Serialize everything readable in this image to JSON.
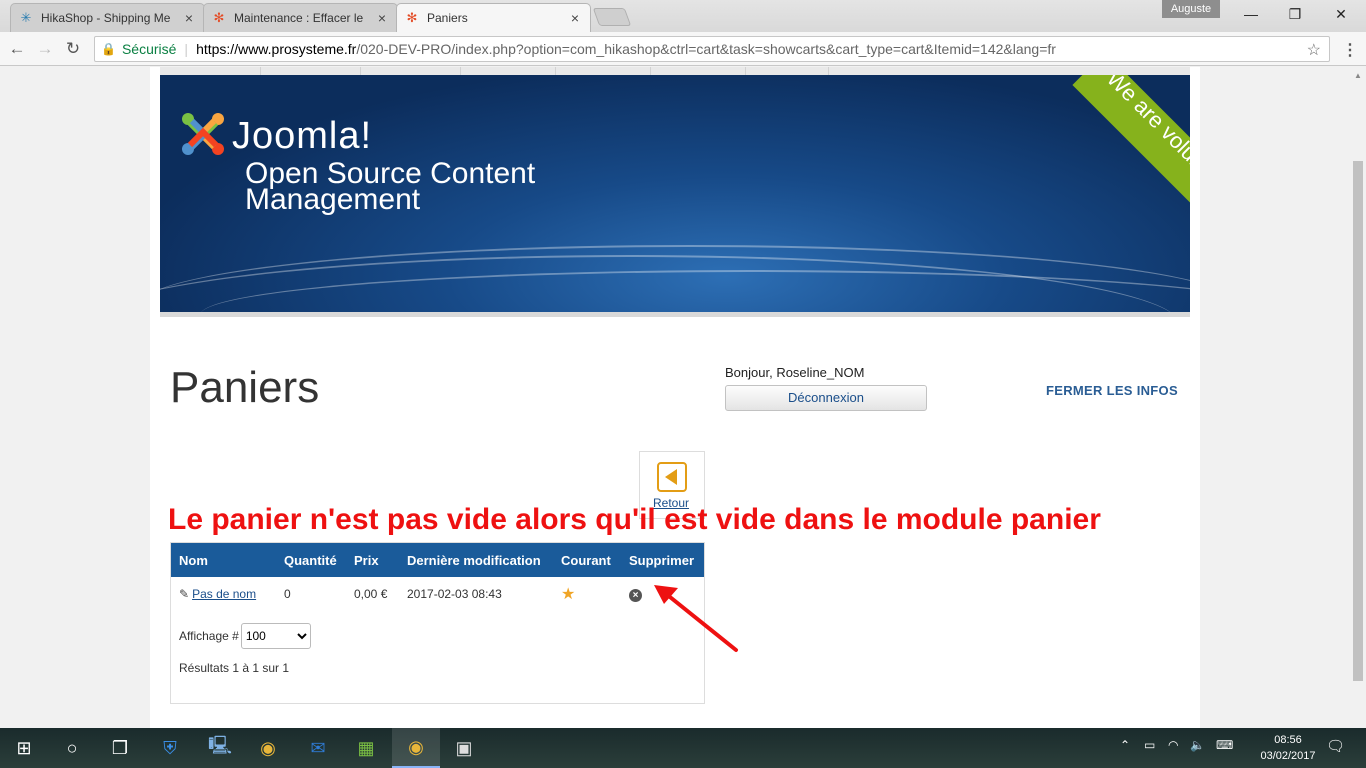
{
  "browser": {
    "tabs": [
      {
        "title": "HikaShop - Shipping Me",
        "favicon": "hikashop-icon"
      },
      {
        "title": "Maintenance : Effacer le",
        "favicon": "joomla-icon"
      },
      {
        "title": "Paniers",
        "favicon": "joomla-icon"
      }
    ],
    "profile_name": "Auguste",
    "secure_label": "Sécurisé",
    "url_host": "https://www.prosysteme.fr",
    "url_rest": "/020-DEV-PRO/index.php?option=com_hikashop&ctrl=cart&task=showcarts&cart_type=cart&Itemid=142&lang=fr"
  },
  "banner": {
    "brand": "Joomla!",
    "tagline_line1": "Open Source Content",
    "tagline_line2": "Management",
    "ribbon": "We are volunteers !"
  },
  "page": {
    "title": "Paniers",
    "greeting": "Bonjour, Roseline_NOM",
    "logout_label": "Déconnexion",
    "close_info_label": "FERMER LES INFOS",
    "back_label": "Retour"
  },
  "annotation": "Le panier n'est pas vide alors qu'il est vide dans le module panier",
  "cart_table": {
    "headers": [
      "Nom",
      "Quantité",
      "Prix",
      "Dernière modification",
      "Courant",
      "Supprimer"
    ],
    "rows": [
      {
        "name": "Pas de nom",
        "quantity": "0",
        "price": "0,00 €",
        "modified": "2017-02-03 08:43"
      }
    ],
    "display_label": "Affichage #",
    "display_value": "100",
    "results": "Résultats 1 à 1 sur 1"
  },
  "taskbar": {
    "time": "08:56",
    "date": "03/02/2017"
  },
  "colors": {
    "table_header": "#1a5b9a",
    "annotation": "#ee1111",
    "ribbon": "#86b21c"
  }
}
